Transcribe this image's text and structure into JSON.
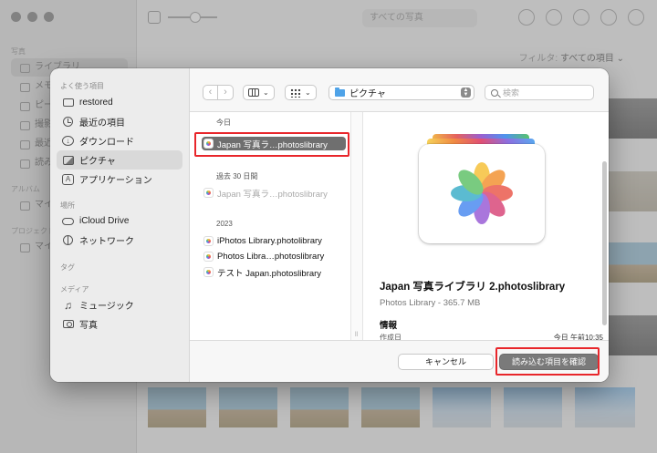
{
  "background": {
    "sidebar": {
      "sections": [
        "写真",
        "アルバム",
        "プロジェクト"
      ],
      "items": [
        "ライブラリ",
        "メモリー",
        "ピープル",
        "撮影地",
        "最近削除した項目",
        "読み込み",
        "マイアルバム",
        "マイプロジェクト"
      ]
    },
    "toolbar": {
      "view_segment": "すべての写真"
    },
    "filter": {
      "label": "フィルタ:",
      "value": "すべての項目 ⌄"
    }
  },
  "dialog": {
    "sidebar": {
      "favorites_heading": "よく使う項目",
      "favorites": [
        {
          "label": "restored",
          "icon": "folder-icon"
        },
        {
          "label": "最近の項目",
          "icon": "clock-icon"
        },
        {
          "label": "ダウンロード",
          "icon": "download-icon"
        },
        {
          "label": "ピクチャ",
          "icon": "pictures-icon"
        },
        {
          "label": "アプリケーション",
          "icon": "applications-icon"
        }
      ],
      "places_heading": "場所",
      "places": [
        {
          "label": "iCloud Drive",
          "icon": "cloud-icon"
        },
        {
          "label": "ネットワーク",
          "icon": "globe-icon"
        }
      ],
      "tags_heading": "タグ",
      "media_heading": "メディア",
      "media": [
        {
          "label": "ミュージック",
          "icon": "music-note-icon"
        },
        {
          "label": "写真",
          "icon": "camera-icon"
        }
      ]
    },
    "toolbar": {
      "back": "‹",
      "forward": "›",
      "view_chevron": "⌄",
      "group_chevron": "⌄",
      "location": "ピクチャ",
      "search_placeholder": "検索"
    },
    "files": {
      "today_heading": "今日",
      "today": [
        "Japan 写真ラ…photoslibrary"
      ],
      "past30_heading": "過去 30 日間",
      "past30": [
        "Japan 写真ラ…photoslibrary"
      ],
      "year_heading": "2023",
      "year": [
        "iPhotos Library.photolibrary",
        "Photos Libra…photoslibrary",
        "テスト Japan.photoslibrary"
      ]
    },
    "preview": {
      "name": "Japan 写真ライブラリ 2.photoslibrary",
      "kind": "Photos Library - 365.7 MB",
      "info_heading": "情報",
      "created_label": "作成日",
      "created_value": "今日 午前10:35"
    },
    "footer": {
      "cancel": "キャンセル",
      "confirm": "読み込む項目を確認"
    }
  },
  "colors": {
    "highlight": "#e8262b",
    "selection": "#6f6f6f",
    "accent_folder": "#4fa3e8"
  }
}
